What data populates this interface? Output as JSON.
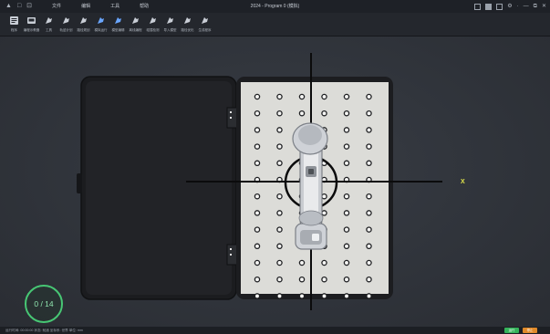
{
  "titlebar": {
    "quick_access": [
      "▲",
      "□",
      "⊡"
    ],
    "menu": [
      "文件",
      "编辑",
      "工具",
      "帮助"
    ],
    "window_title": "2024 - Program 0 (模拟)",
    "right_controls": [
      "⚙",
      "·",
      "—",
      "⧉",
      "✕"
    ]
  },
  "toolbar": {
    "buttons": [
      {
        "id": "b0",
        "label": "程序",
        "icon": "document-icon"
      },
      {
        "id": "b1",
        "label": "编程示教器",
        "icon": "teach-pendant-icon"
      },
      {
        "id": "b2",
        "label": "工具",
        "icon": "tool-icon"
      },
      {
        "id": "b3",
        "label": "轨迹计划",
        "icon": "trajectory-icon"
      },
      {
        "id": "b4",
        "label": "路径规划",
        "icon": "path-icon"
      },
      {
        "id": "b5",
        "label": "模拟运行",
        "icon": "simulate-icon"
      },
      {
        "id": "b6",
        "label": "模型编辑",
        "icon": "model-icon"
      },
      {
        "id": "b7",
        "label": "离线编程",
        "icon": "offline-icon"
      },
      {
        "id": "b8",
        "label": "碰撞检测",
        "icon": "collision-icon"
      },
      {
        "id": "b9",
        "label": "导入模型",
        "icon": "import-icon"
      },
      {
        "id": "b10",
        "label": "路径优化",
        "icon": "optimize-icon"
      },
      {
        "id": "b11",
        "label": "生成程序",
        "icon": "generate-icon"
      }
    ],
    "active_buttons": [
      "b5",
      "b6"
    ]
  },
  "viewport": {
    "axis_label": "X",
    "counter": {
      "done": "0",
      "total": "14",
      "text": "0 / 14"
    }
  },
  "statusbar": {
    "left_text": "运行时间: 00:00:00   状态: 就绪   坐标系: 世界   单位: mm",
    "badge_green_text": "运行",
    "badge_orange_text": "停止",
    "colors": {
      "green": "#35b35a",
      "orange": "#e08a2a"
    }
  }
}
